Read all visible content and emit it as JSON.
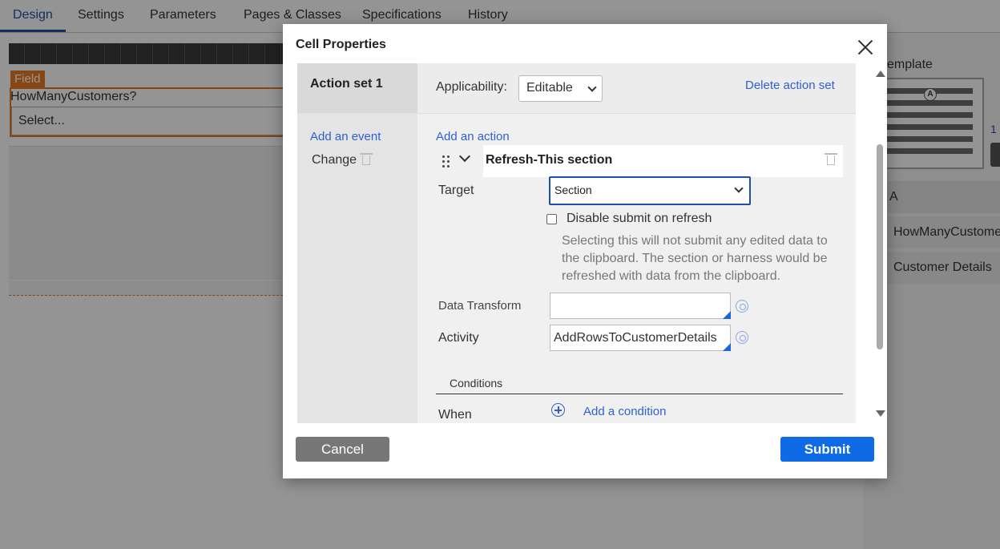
{
  "tabs": [
    "Design",
    "Settings",
    "Parameters",
    "Pages & Classes",
    "Specifications",
    "History"
  ],
  "canvas": {
    "field_tag": "Field",
    "field_label": "HowManyCustomers?",
    "select_value": "Select..."
  },
  "right_panel": {
    "title_fragment": "emplate",
    "template_badge": "A",
    "side_number": "1",
    "column_header": "A",
    "rows": [
      "HowManyCustome",
      "Customer Details"
    ]
  },
  "modal": {
    "title": "Cell Properties",
    "action_set_label": "Action set 1",
    "applicability_label": "Applicability:",
    "applicability_value": "Editable",
    "delete_action_set": "Delete action set",
    "add_event": "Add an event",
    "event_name": "Change",
    "add_action": "Add an action",
    "action_title": "Refresh-This section",
    "target_label": "Target",
    "target_value": "Section",
    "disable_submit_label": "Disable submit on refresh",
    "disable_submit_checked": false,
    "help_text": "Selecting this will not submit any edited data to the clipboard. The section or harness would be refreshed with data from the clipboard.",
    "data_transform_label": "Data Transform",
    "data_transform_value": "",
    "activity_label": "Activity",
    "activity_value": "AddRowsToCustomerDetails",
    "conditions_label": "Conditions",
    "when_label": "When",
    "add_condition": "Add a condition",
    "cancel_label": "Cancel",
    "submit_label": "Submit"
  },
  "colors": {
    "accent_blue": "#1f4fa8",
    "link_blue": "#2f5fcf",
    "submit_blue": "#0f6ae6",
    "field_orange": "#e97b25",
    "cancel_grey": "#777777"
  }
}
